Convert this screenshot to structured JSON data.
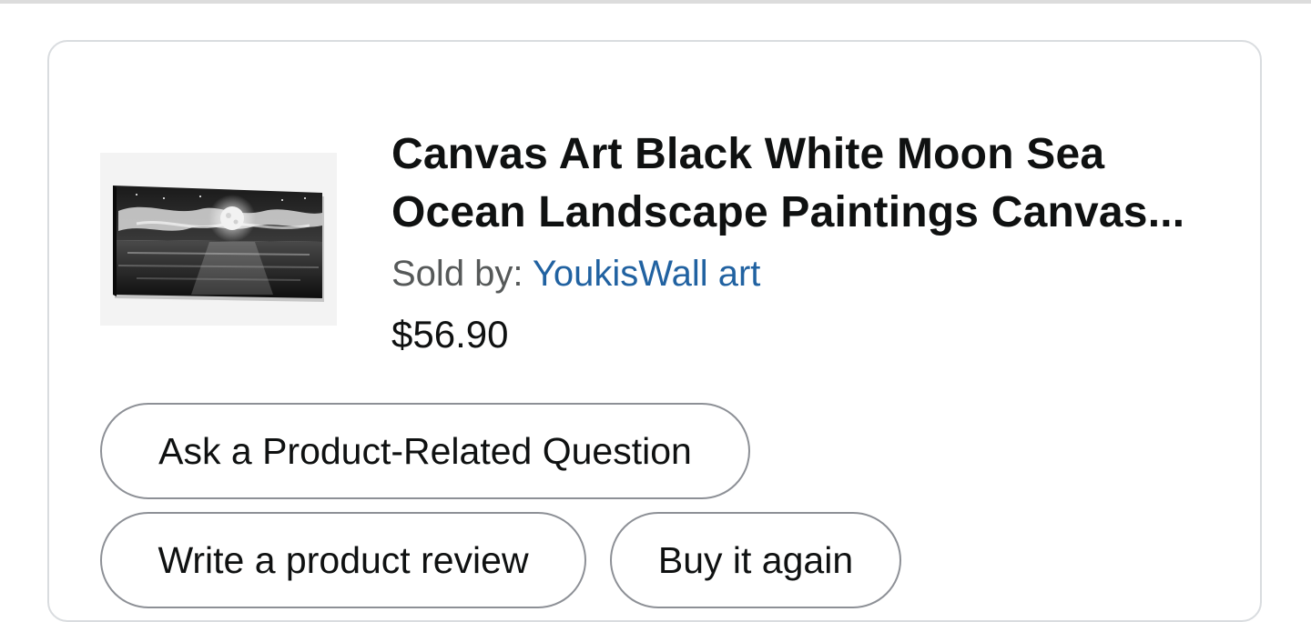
{
  "product": {
    "title": "Canvas Art Black White Moon Sea Ocean Landscape Paintings Canvas...",
    "sold_by_label": "Sold by: ",
    "seller_name": "YoukisWall art",
    "price": "$56.90",
    "image_alt": "Black and white moon over the sea canvas print"
  },
  "actions": {
    "ask_question": "Ask a Product-Related Question",
    "write_review": "Write a product review",
    "buy_again": "Buy it again"
  },
  "colors": {
    "link": "#2162a1",
    "text": "#0f1111",
    "muted": "#565959",
    "border": "#8d9096"
  }
}
